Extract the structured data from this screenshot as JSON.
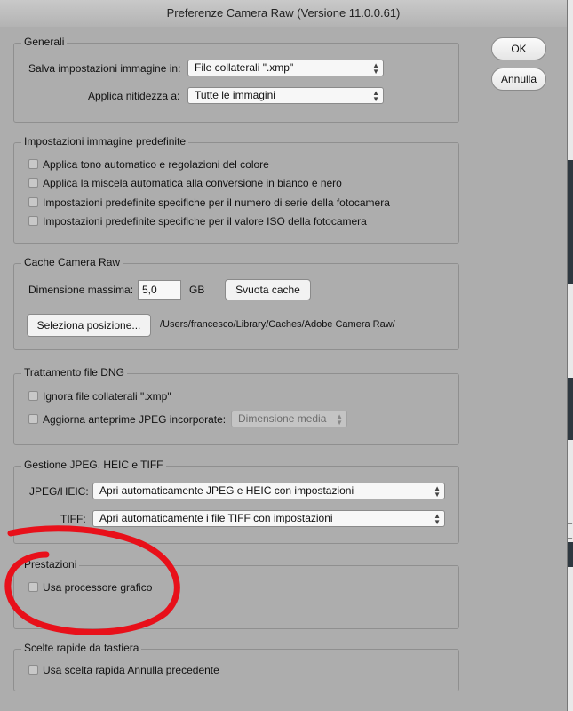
{
  "window": {
    "title": "Preferenze Camera Raw  (Versione 11.0.0.61)"
  },
  "buttons": {
    "ok": "OK",
    "cancel": "Annulla"
  },
  "general": {
    "title": "Generali",
    "save_settings_label": "Salva impostazioni immagine in:",
    "save_settings_value": "File collaterali \".xmp\"",
    "sharpen_label": "Applica nitidezza a:",
    "sharpen_value": "Tutte le immagini"
  },
  "defaults": {
    "title": "Impostazioni immagine predefinite",
    "items": [
      "Applica tono automatico e regolazioni del colore",
      "Applica la miscela automatica alla conversione in bianco e nero",
      "Impostazioni predefinite specifiche per il numero di serie della fotocamera",
      "Impostazioni predefinite specifiche per il valore ISO della fotocamera"
    ]
  },
  "cache": {
    "title": "Cache Camera Raw",
    "max_size_label": "Dimensione massima:",
    "max_size_value": "5,0",
    "unit": "GB",
    "purge_button": "Svuota cache",
    "select_location_button": "Seleziona posizione...",
    "path": "/Users/francesco/Library/Caches/Adobe Camera Raw/"
  },
  "dng": {
    "title": "Trattamento file DNG",
    "ignore_sidecar": "Ignora file collaterali \".xmp\"",
    "update_previews": "Aggiorna anteprime JPEG incorporate:",
    "preview_size_value": "Dimensione media"
  },
  "jpeg_tiff": {
    "title": "Gestione JPEG, HEIC e TIFF",
    "jpeg_label": "JPEG/HEIC:",
    "jpeg_value": "Apri automaticamente JPEG e HEIC con impostazioni",
    "tiff_label": "TIFF:",
    "tiff_value": "Apri automaticamente i file TIFF con impostazioni"
  },
  "performance": {
    "title": "Prestazioni",
    "gpu": "Usa processore grafico"
  },
  "shortcuts": {
    "title": "Scelte rapide da tastiera",
    "undo": "Usa scelta rapida Annulla precedente"
  },
  "background": {
    "fragment_1": "_",
    "fragment_2": "_"
  },
  "colors": {
    "annotation": "#e8101a"
  }
}
